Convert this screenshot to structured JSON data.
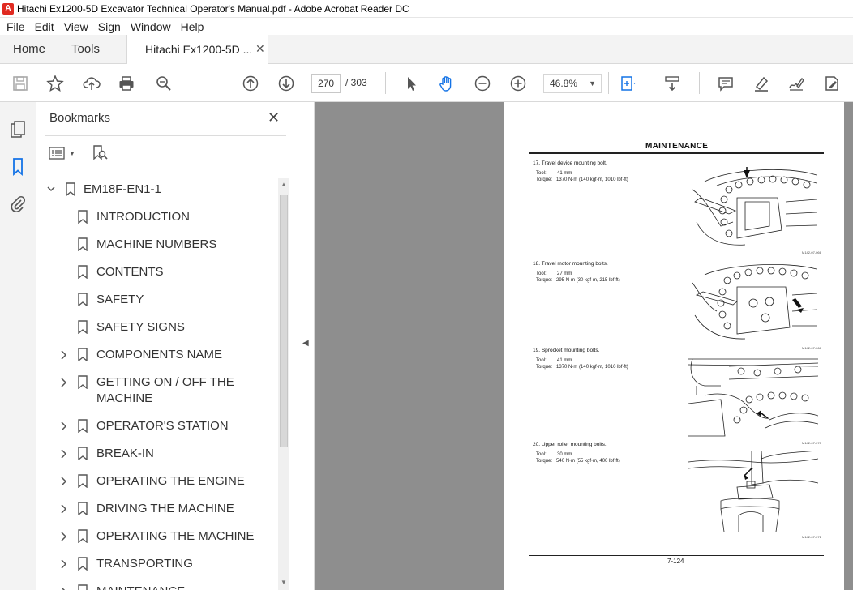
{
  "window": {
    "title": "Hitachi Ex1200-5D Excavator Technical Operator's Manual.pdf - Adobe Acrobat Reader DC"
  },
  "menu": [
    "File",
    "Edit",
    "View",
    "Sign",
    "Window",
    "Help"
  ],
  "tabs": {
    "home": "Home",
    "tools": "Tools",
    "document": "Hitachi Ex1200-5D ...",
    "close": "✕"
  },
  "toolbar": {
    "current_page": "270",
    "total_pages": "/ 303",
    "zoom": "46.8%",
    "icons": [
      "save-icon",
      "star-icon",
      "upload-icon",
      "print-icon",
      "zoom-search-icon",
      "page-up-icon",
      "page-down-icon",
      "select-cursor-icon",
      "hand-tool-icon",
      "zoom-out-icon",
      "zoom-in-icon",
      "fit-page-icon",
      "scroll-mode-icon",
      "comment-icon",
      "highlight-icon",
      "sign-icon",
      "edit-icon"
    ]
  },
  "bookmarks": {
    "title": "Bookmarks",
    "close": "✕",
    "root": "EM18F-EN1-1",
    "items": [
      {
        "label": "INTRODUCTION",
        "expandable": false
      },
      {
        "label": "MACHINE NUMBERS",
        "expandable": false
      },
      {
        "label": "CONTENTS",
        "expandable": false
      },
      {
        "label": "SAFETY",
        "expandable": false
      },
      {
        "label": "SAFETY SIGNS",
        "expandable": false
      },
      {
        "label": "COMPONENTS NAME",
        "expandable": true
      },
      {
        "label": "GETTING ON / OFF THE",
        "label2": "MACHINE",
        "expandable": true
      },
      {
        "label": "OPERATOR'S STATION",
        "expandable": true
      },
      {
        "label": "BREAK-IN",
        "expandable": true
      },
      {
        "label": "OPERATING THE ENGINE",
        "expandable": true
      },
      {
        "label": "DRIVING THE MACHINE",
        "expandable": true
      },
      {
        "label": "OPERATING THE MACHINE",
        "expandable": true
      },
      {
        "label": "TRANSPORTING",
        "expandable": true
      },
      {
        "label": "MAINTENANCE",
        "expandable": true
      }
    ]
  },
  "document": {
    "header": "MAINTENANCE",
    "sections": [
      {
        "title": "17.  Travel device mounting bolt.",
        "tool": "41 mm",
        "torque": "1370 N·m (140 kgf·m, 1010 lbf·ft)",
        "fig": "M142-07-066"
      },
      {
        "title": "18.  Travel motor mounting bolts.",
        "tool": "27 mm",
        "torque": "295 N·m (30 kgf·m, 215 lbf·ft)",
        "fig": "M142-07-068"
      },
      {
        "title": "19.  Sprocket mounting bolts.",
        "tool": "41 mm",
        "torque": "1370 N·m (140 kgf·m, 1010 lbf·ft)",
        "fig": "M142-07-070"
      },
      {
        "title": "20.  Upper roller mounting bolts.",
        "tool": "30 mm",
        "torque": "540 N·m (55 kgf·m, 400 lbf·ft)",
        "fig": "M142-07-071"
      }
    ],
    "tool_label": "Tool:",
    "torque_label": "Torque:",
    "page_number": "7-124"
  }
}
